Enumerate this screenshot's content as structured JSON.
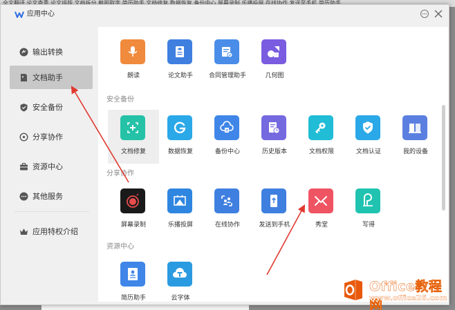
{
  "background": {
    "top_strip_text": "全文翻译   论文查重   论文排版   文档拆分   截图取字   简历助手   文档修复   数据恢复   备份中心   屏幕录制   乐播投屏   在线协作   发送至手机   简历助手"
  },
  "window": {
    "title": "应用中心",
    "icons": {
      "logo": "wps-logo-icon",
      "feedback": "feedback-icon",
      "close": "close-icon"
    }
  },
  "sidebar": {
    "items": [
      {
        "label": "输出转换",
        "icon": "convert-icon"
      },
      {
        "label": "文档助手",
        "icon": "document-icon",
        "active": true
      },
      {
        "label": "安全备份",
        "icon": "shield-icon"
      },
      {
        "label": "分享协作",
        "icon": "share-icon"
      },
      {
        "label": "资源中心",
        "icon": "briefcase-icon"
      },
      {
        "label": "其他服务",
        "icon": "more-icon"
      },
      {
        "label": "应用特权介绍",
        "icon": "crown-icon"
      }
    ]
  },
  "sections": [
    {
      "title": ""
    },
    {
      "title": "安全备份"
    },
    {
      "title": "分享协作"
    },
    {
      "title": "资源中心"
    }
  ],
  "apps": {
    "doc": [
      {
        "label": "朗读",
        "color": "#f08a3c",
        "icon": "microphone-icon"
      },
      {
        "label": "论文助手",
        "color": "#3f7fe0",
        "icon": "thesis-icon"
      },
      {
        "label": "合同管理助手",
        "color": "#4a8de8",
        "icon": "contract-icon"
      },
      {
        "label": "几何图",
        "color": "#7a5ce0",
        "icon": "geometry-icon"
      }
    ],
    "security": [
      {
        "label": "文档修复",
        "color": "#25c2a8",
        "icon": "repair-icon",
        "selected": true
      },
      {
        "label": "数据恢复",
        "color": "#2aa8e8",
        "icon": "recover-icon"
      },
      {
        "label": "备份中心",
        "color": "#3f86e8",
        "icon": "cloud-backup-icon"
      },
      {
        "label": "历史版本",
        "color": "#7569e0",
        "icon": "history-icon"
      },
      {
        "label": "文档权限",
        "color": "#21bcd6",
        "icon": "key-icon"
      },
      {
        "label": "文档认证",
        "color": "#2aa8e8",
        "icon": "verify-shield-icon"
      },
      {
        "label": "我的设备",
        "color": "#5b7fe0",
        "icon": "device-icon"
      }
    ],
    "share": [
      {
        "label": "屏幕录制",
        "color": "#1a1a1a",
        "icon": "record-icon"
      },
      {
        "label": "乐播投屏",
        "color": "#2f86e0",
        "icon": "cast-icon"
      },
      {
        "label": "在线协作",
        "color": "#3f7fe0",
        "icon": "collaborate-icon"
      },
      {
        "label": "发送到手机",
        "color": "#3f7fe0",
        "icon": "phone-send-icon"
      },
      {
        "label": "秀堂",
        "color": "#ef5463",
        "icon": "xiutang-icon"
      },
      {
        "label": "写得",
        "color": "#20c3b0",
        "icon": "write-icon"
      }
    ],
    "resource": [
      {
        "label": "简历助手",
        "color": "#3f86e8",
        "icon": "resume-icon"
      },
      {
        "label": "云字体",
        "color": "#2a9be0",
        "icon": "cloud-font-icon"
      }
    ]
  },
  "watermark": {
    "title": "Office教程网",
    "url": "www.office26.com",
    "logo": "office-logo-icon"
  }
}
